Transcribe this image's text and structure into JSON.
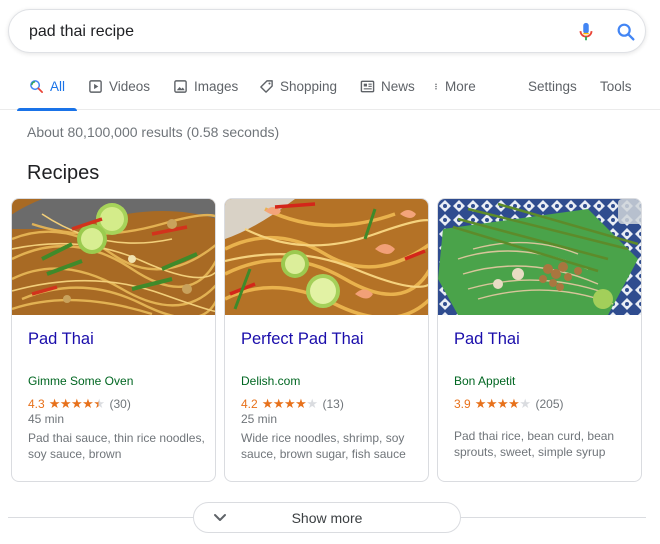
{
  "search": {
    "query": "pad thai recipe",
    "mic_icon": "mic-icon",
    "search_icon": "search-icon"
  },
  "tabs": [
    {
      "label": "All",
      "icon": "search-icon",
      "active": true
    },
    {
      "label": "Videos",
      "icon": "video-icon"
    },
    {
      "label": "Images",
      "icon": "image-icon"
    },
    {
      "label": "Shopping",
      "icon": "tag-icon"
    },
    {
      "label": "News",
      "icon": "news-icon"
    },
    {
      "label": "More",
      "icon": "more-vert-icon"
    }
  ],
  "tools": {
    "settings": "Settings",
    "tools": "Tools"
  },
  "result_stats": "About 80,100,000 results (0.58 seconds)",
  "recipes": {
    "title": "Recipes",
    "cards": [
      {
        "title": "Pad Thai",
        "source": "Gimme Some Oven",
        "rating": "4.3",
        "rating_value": 4.3,
        "count": "(30)",
        "time": "45 min",
        "desc": "Pad thai sauce, thin rice noodles, soy sauce, brown"
      },
      {
        "title": "Perfect Pad Thai",
        "source": "Delish.com",
        "rating": "4.2",
        "rating_value": 4.2,
        "count": "(13)",
        "time": "25 min",
        "desc": "Wide rice noodles, shrimp, soy sauce, brown sugar, fish sauce"
      },
      {
        "title": "Pad Thai",
        "source": "Bon Appetit",
        "rating": "3.9",
        "rating_value": 3.9,
        "count": "(205)",
        "time": "",
        "desc": "Pad thai rice, bean curd, bean sprouts, sweet, simple syrup"
      }
    ]
  },
  "show_more": {
    "label": "Show more",
    "icon": "chevron-down-icon"
  },
  "colors": {
    "link": "#1a0dab",
    "source": "#006621",
    "star": "#e7711b",
    "accent": "#1a73e8",
    "muted": "#70757a"
  }
}
